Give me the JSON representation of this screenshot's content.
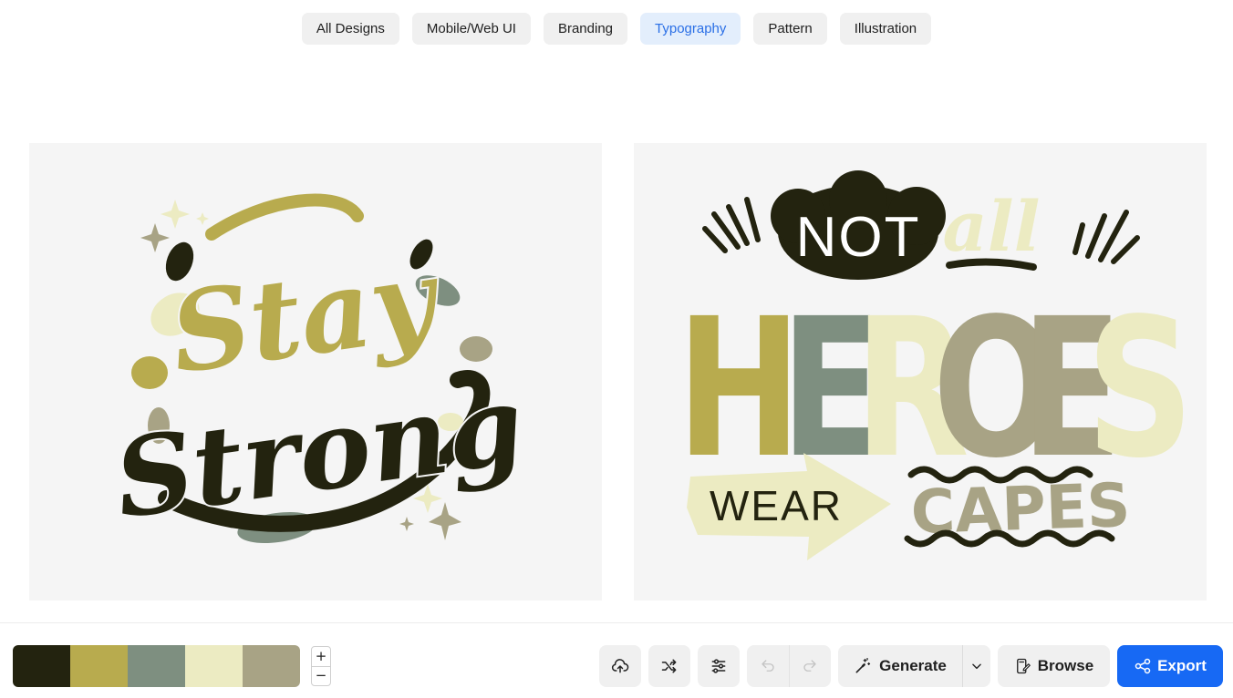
{
  "tabs": [
    {
      "label": "All Designs",
      "active": false
    },
    {
      "label": "Mobile/Web UI",
      "active": false
    },
    {
      "label": "Branding",
      "active": false
    },
    {
      "label": "Typography",
      "active": true
    },
    {
      "label": "Pattern",
      "active": false
    },
    {
      "label": "Illustration",
      "active": false
    }
  ],
  "artworks": {
    "left": {
      "line1": "Stay",
      "line2": "Strong"
    },
    "right": {
      "not": "NOT",
      "all": "all",
      "heroes": [
        "H",
        "E",
        "R",
        "O",
        "E",
        "S"
      ],
      "wear": "WEAR",
      "capes": "CAPES"
    }
  },
  "palette": {
    "colors": [
      "#23230f",
      "#b8ab4e",
      "#7e8f80",
      "#ecebc2",
      "#a8a385"
    ]
  },
  "stepper": {
    "plus": "+",
    "minus": "−"
  },
  "toolbar": {
    "upload_icon": "upload-cloud-icon",
    "shuffle_icon": "shuffle-icon",
    "adjust_icon": "sliders-icon",
    "undo_icon": "undo-icon",
    "redo_icon": "redo-icon",
    "generate_label": "Generate",
    "browse_label": "Browse",
    "export_label": "Export"
  },
  "colors": {
    "accent": "#1769f4",
    "active_tab_bg": "#e3eefc",
    "active_tab_text": "#2a6fe6"
  }
}
